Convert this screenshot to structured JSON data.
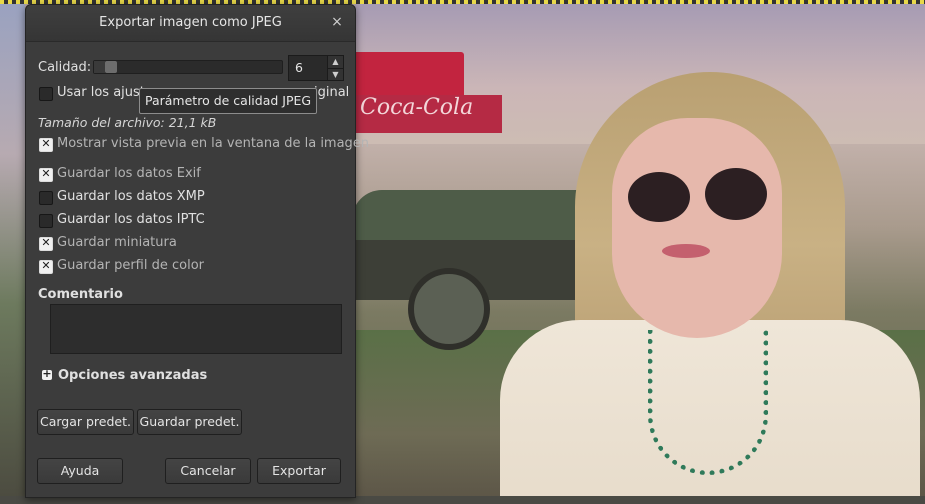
{
  "dialog": {
    "title": "Exportar imagen como JPEG",
    "close_glyph": "×",
    "quality_label": "Calidad:",
    "quality_value": "6",
    "quality_fraction": 0.06,
    "use_original_label_left": "Usar los ajust",
    "use_original_label_right": "iginal",
    "tooltip": "Parámetro de calidad JPEG",
    "file_size": "Tamaño del archivo: 21,1 kB",
    "preview_label": "Mostrar vista previa en la ventana de la imagen",
    "options": [
      {
        "label": "Guardar los datos Exif",
        "checked": true
      },
      {
        "label": "Guardar los datos XMP",
        "checked": false
      },
      {
        "label": "Guardar los datos IPTC",
        "checked": false
      },
      {
        "label": "Guardar miniatura",
        "checked": true
      },
      {
        "label": "Guardar perfil de color",
        "checked": true
      }
    ],
    "comment_label": "Comentario",
    "comment_value": "",
    "advanced_label": "Opciones avanzadas",
    "load_defaults": "Cargar predet.",
    "save_defaults": "Guardar predet.",
    "help": "Ayuda",
    "cancel": "Cancelar",
    "export": "Exportar"
  },
  "background": {
    "sign_text": "Coca-Cola"
  },
  "icons": {
    "close": "close-icon",
    "spin_up": "chevron-up-icon",
    "spin_down": "chevron-down-icon",
    "check": "check-icon",
    "expander": "plus-icon"
  }
}
